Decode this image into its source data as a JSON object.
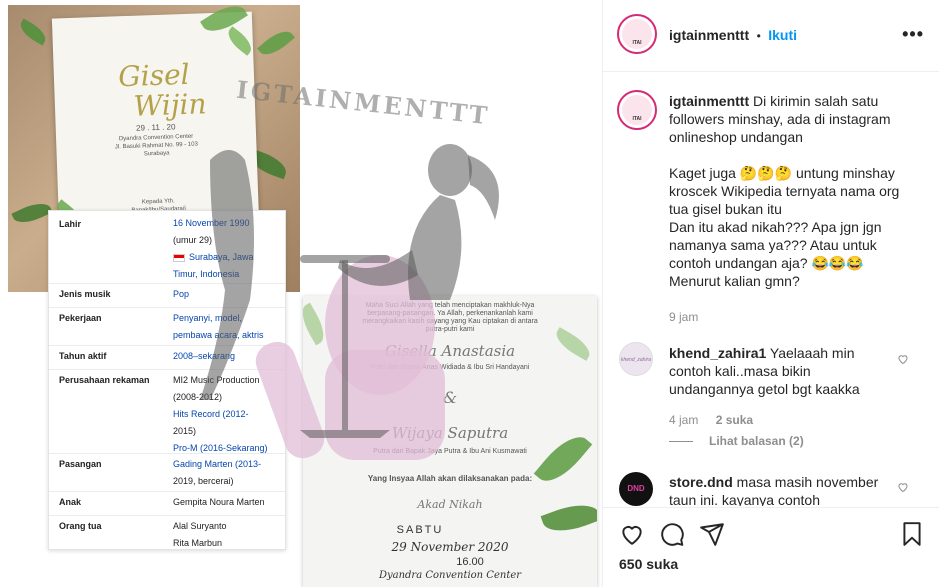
{
  "post": {
    "username": "igtainmenttt",
    "follow_separator": "•",
    "follow_label": "Ikuti",
    "more_icon": "more-horizontal-icon"
  },
  "media": {
    "watermark": "IGTAINMENTTT",
    "card1": {
      "names_line1": "Gisel",
      "names_line2": "Wijin",
      "date": "29 . 11 . 20",
      "venue": "Dyandra Convention Center",
      "address": "Jl. Basuki Rahmat No. 99 - 103",
      "city": "Surabaya",
      "footer1": "Kepada Yth.",
      "footer2": "Bapak/Ibu/Saudara/i"
    },
    "wiki": {
      "rows": [
        {
          "label": "Lahir",
          "values": [
            "16 November 1990",
            "(umur 29)",
            "Surabaya, Jawa",
            "Timur, Indonesia"
          ]
        },
        {
          "label": "Jenis musik",
          "values": [
            "Pop"
          ]
        },
        {
          "label": "Pekerjaan",
          "values": [
            "Penyanyi, model,",
            "pembawa acara, aktris"
          ]
        },
        {
          "label": "Tahun aktif",
          "values": [
            "2008–sekarang"
          ]
        },
        {
          "label": "Perusahaan rekaman",
          "values": [
            "MI2 Music Production",
            "(2008-2012)",
            "Hits Record (2012-",
            "2015)",
            "Pro-M (2016-Sekarang)"
          ]
        },
        {
          "label": "Pasangan",
          "values": [
            "Gading Marten (2013-",
            "2019, bercerai)"
          ]
        },
        {
          "label": "Anak",
          "values": [
            "Gempita Noura Marten"
          ]
        },
        {
          "label": "Orang tua",
          "values": [
            "Alal Suryanto",
            "Rita Marbun"
          ]
        }
      ]
    },
    "card2": {
      "intro1": "Maha Suci Allah yang telah menciptakan makhluk-Nya",
      "intro2": "berpasang-pasangan. Ya Allah, perkenankanlah kami",
      "intro3": "merangkaikan kasih sayang yang Kau ciptakan di antara",
      "intro4": "putra-putri kami",
      "bride": "Gisella Anastasia",
      "bride_parents": "Putri dari Bapak Anas Widiada & Ibu Sri Handayani",
      "amp": "&",
      "groom": "Wijaya Saputra",
      "groom_parents": "Putra dari Bapak Jaya Putra & Ibu Ani Kusmawati",
      "invite": "Yang Insyaa Allah akan dilaksanakan pada:",
      "event": "Akad Nikah",
      "day": "SABTU",
      "date": "29 November 2020",
      "time": "16.00",
      "venue": "Dyandra Convention Center"
    }
  },
  "caption": {
    "username": "igtainmenttt",
    "text1": " Di kirimin salah satu followers minshay, ada di instagram onlineshop undangan",
    "text2": "Kaget juga 🤔🤔🤔 untung minshay kroscek Wikipedia ternyata nama org tua gisel bukan itu\nDan itu akad nikah??? Apa jgn jgn namanya sama ya??? Atau untuk contoh undangan aja? 😂😂😂\nMenurut kalian gmn?",
    "time": "9 jam"
  },
  "comments": [
    {
      "username": "khend_zahira1",
      "text": " Yaelaaah min contoh kali..masa bikin undangannya getol bgt kaakka",
      "time": "4 jam",
      "likes": "2 suka",
      "replies": "Lihat balasan (2)",
      "avatar_text": "khend_zahira"
    },
    {
      "username": "store.dnd",
      "text": " masa masih november taun ini. kayanya contoh",
      "avatar_text": "DND"
    }
  ],
  "actions": {
    "like_icon": "heart-icon",
    "comment_icon": "comment-icon",
    "share_icon": "share-icon",
    "save_icon": "bookmark-icon",
    "likes": "650 suka"
  },
  "colors": {
    "link_blue": "#0095f6",
    "wiki_link": "#0645ad",
    "muted": "#8e8e8e",
    "brand_pink": "#d62976"
  }
}
